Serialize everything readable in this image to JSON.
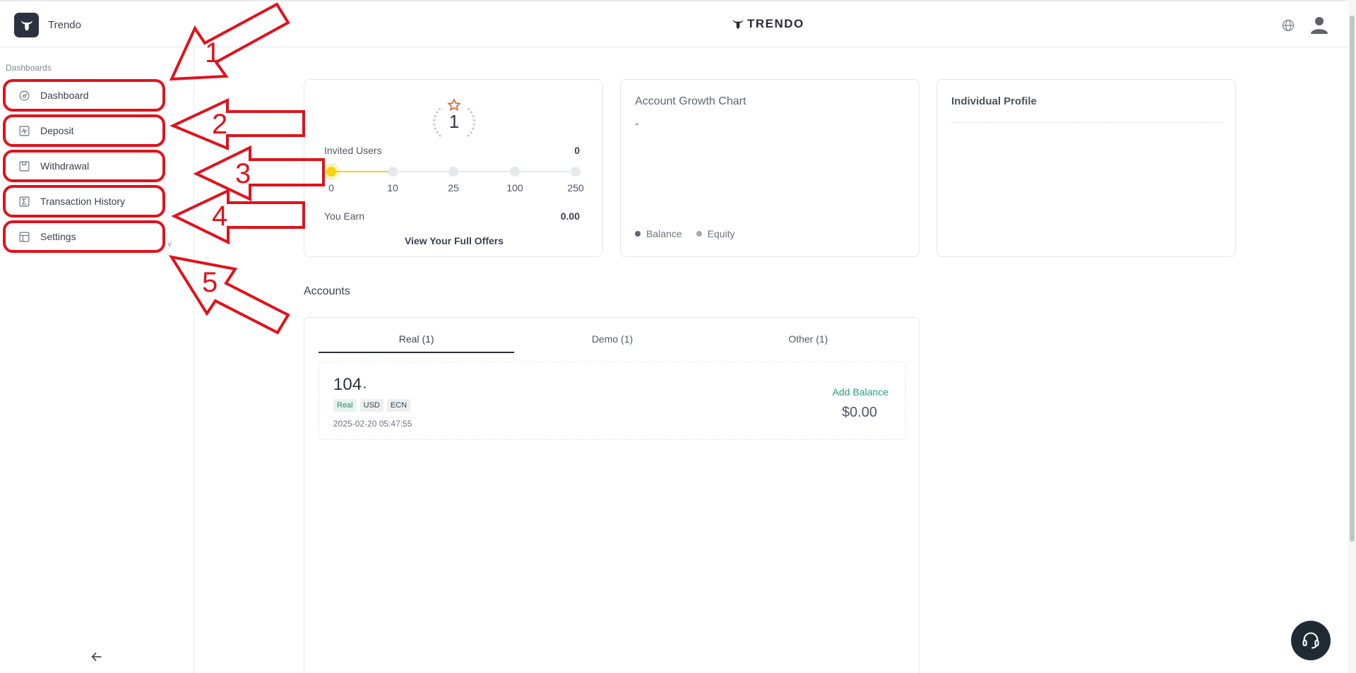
{
  "header": {
    "brand_name": "Trendo",
    "center_logo_text": "TRENDO"
  },
  "sidebar": {
    "section_label": "Dashboards",
    "items": [
      {
        "label": "Dashboard",
        "icon": "gauge-icon"
      },
      {
        "label": "Deposit",
        "icon": "activity-chart-icon"
      },
      {
        "label": "Withdrawal",
        "icon": "save-disk-icon"
      },
      {
        "label": "Transaction History",
        "icon": "sigma-icon"
      },
      {
        "label": "Settings",
        "icon": "layout-table-icon"
      }
    ]
  },
  "annotations": [
    "1",
    "2",
    "3",
    "4",
    "5"
  ],
  "referral_card": {
    "level": "1",
    "invited_label": "Invited Users",
    "invited_value": "0",
    "progress_value": 0,
    "milestones": [
      "0",
      "10",
      "25",
      "100",
      "250"
    ],
    "earn_label": "You Earn",
    "earn_value": "0.00",
    "link_label": "View Your Full Offers"
  },
  "growth_card": {
    "title": "Account Growth Chart",
    "value": "-",
    "legend": [
      {
        "label": "Balance",
        "color": "#5f6673"
      },
      {
        "label": "Equity",
        "color": "#a4a9b2"
      }
    ]
  },
  "profile_card": {
    "title": "Individual Profile"
  },
  "accounts": {
    "heading": "Accounts",
    "tabs": [
      "Real (1)",
      "Demo (1)",
      "Other (1)"
    ],
    "active_tab": 0,
    "items": [
      {
        "number": "104",
        "tags": [
          "Real",
          "USD",
          "ECN"
        ],
        "created": "2025-02-20 05:47:55",
        "add_balance_label": "Add Balance",
        "balance": "$0.00"
      }
    ]
  },
  "colors": {
    "annotation_red": "#e0121c",
    "accent_green": "#2b9b82",
    "progress_yellow": "#f6d40c"
  }
}
